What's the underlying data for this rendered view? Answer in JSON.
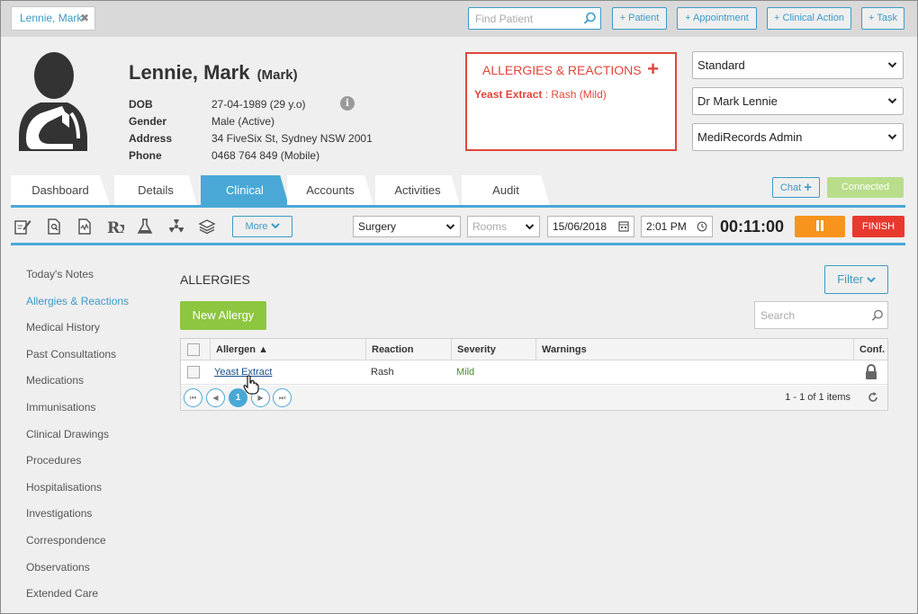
{
  "topbar": {
    "patient_tab": "Lennie, Mark",
    "find_placeholder": "Find Patient",
    "buttons": [
      "+ Patient",
      "+ Appointment",
      "+ Clinical Action",
      "+ Task"
    ]
  },
  "patient": {
    "name": "Lennie, Mark",
    "nickname": "(Mark)",
    "fields": [
      {
        "label": "DOB",
        "value": "27-04-1989 (29 y.o)"
      },
      {
        "label": "Gender",
        "value": "Male (Active)"
      },
      {
        "label": "Address",
        "value": "34 FiveSix St, Sydney NSW 2001"
      },
      {
        "label": "Phone",
        "value": "0468 764 849 (Mobile)"
      }
    ]
  },
  "allergy_panel": {
    "title": "ALLERGIES & REACTIONS",
    "add": "+",
    "entry_name": "Yeast Extract",
    "entry_detail": " : Rash (Mild)"
  },
  "selectors": [
    "Standard",
    "Dr Mark Lennie",
    "MediRecords Admin"
  ],
  "tabs": [
    {
      "label": "Dashboard"
    },
    {
      "label": "Details"
    },
    {
      "label": "Clinical"
    },
    {
      "label": "Accounts"
    },
    {
      "label": "Activities"
    },
    {
      "label": "Audit"
    }
  ],
  "chat": {
    "label": "Chat",
    "plus": "+"
  },
  "connection": "Connected",
  "toolbar": {
    "more": "More",
    "location": "Surgery",
    "rooms": "Rooms",
    "date": "15/06/2018",
    "time": "2:01 PM",
    "timer": "00:11:00",
    "finish": "FINISH"
  },
  "sidebar": [
    "Today's Notes",
    "Allergies & Reactions",
    "Medical History",
    "Past Consultations",
    "Medications",
    "Immunisations",
    "Clinical Drawings",
    "Procedures",
    "Hospitalisations",
    "Investigations",
    "Correspondence",
    "Observations",
    "Extended Care"
  ],
  "allergies": {
    "title": "ALLERGIES",
    "filter": "Filter",
    "new_button": "New Allergy",
    "search_placeholder": "Search",
    "columns": [
      "Allergen ▲",
      "Reaction",
      "Severity",
      "Warnings",
      "Conf."
    ],
    "rows": [
      {
        "allergen": "Yeast Extract",
        "reaction": "Rash",
        "severity": "Mild",
        "warnings": ""
      }
    ],
    "page": "1",
    "items_text": "1 - 1 of 1 items"
  },
  "colors": {
    "accent": "#4aa8d6",
    "alert": "#e0463c",
    "success": "#8dc63f",
    "pause": "#f7941d",
    "finish": "#e8392f"
  }
}
